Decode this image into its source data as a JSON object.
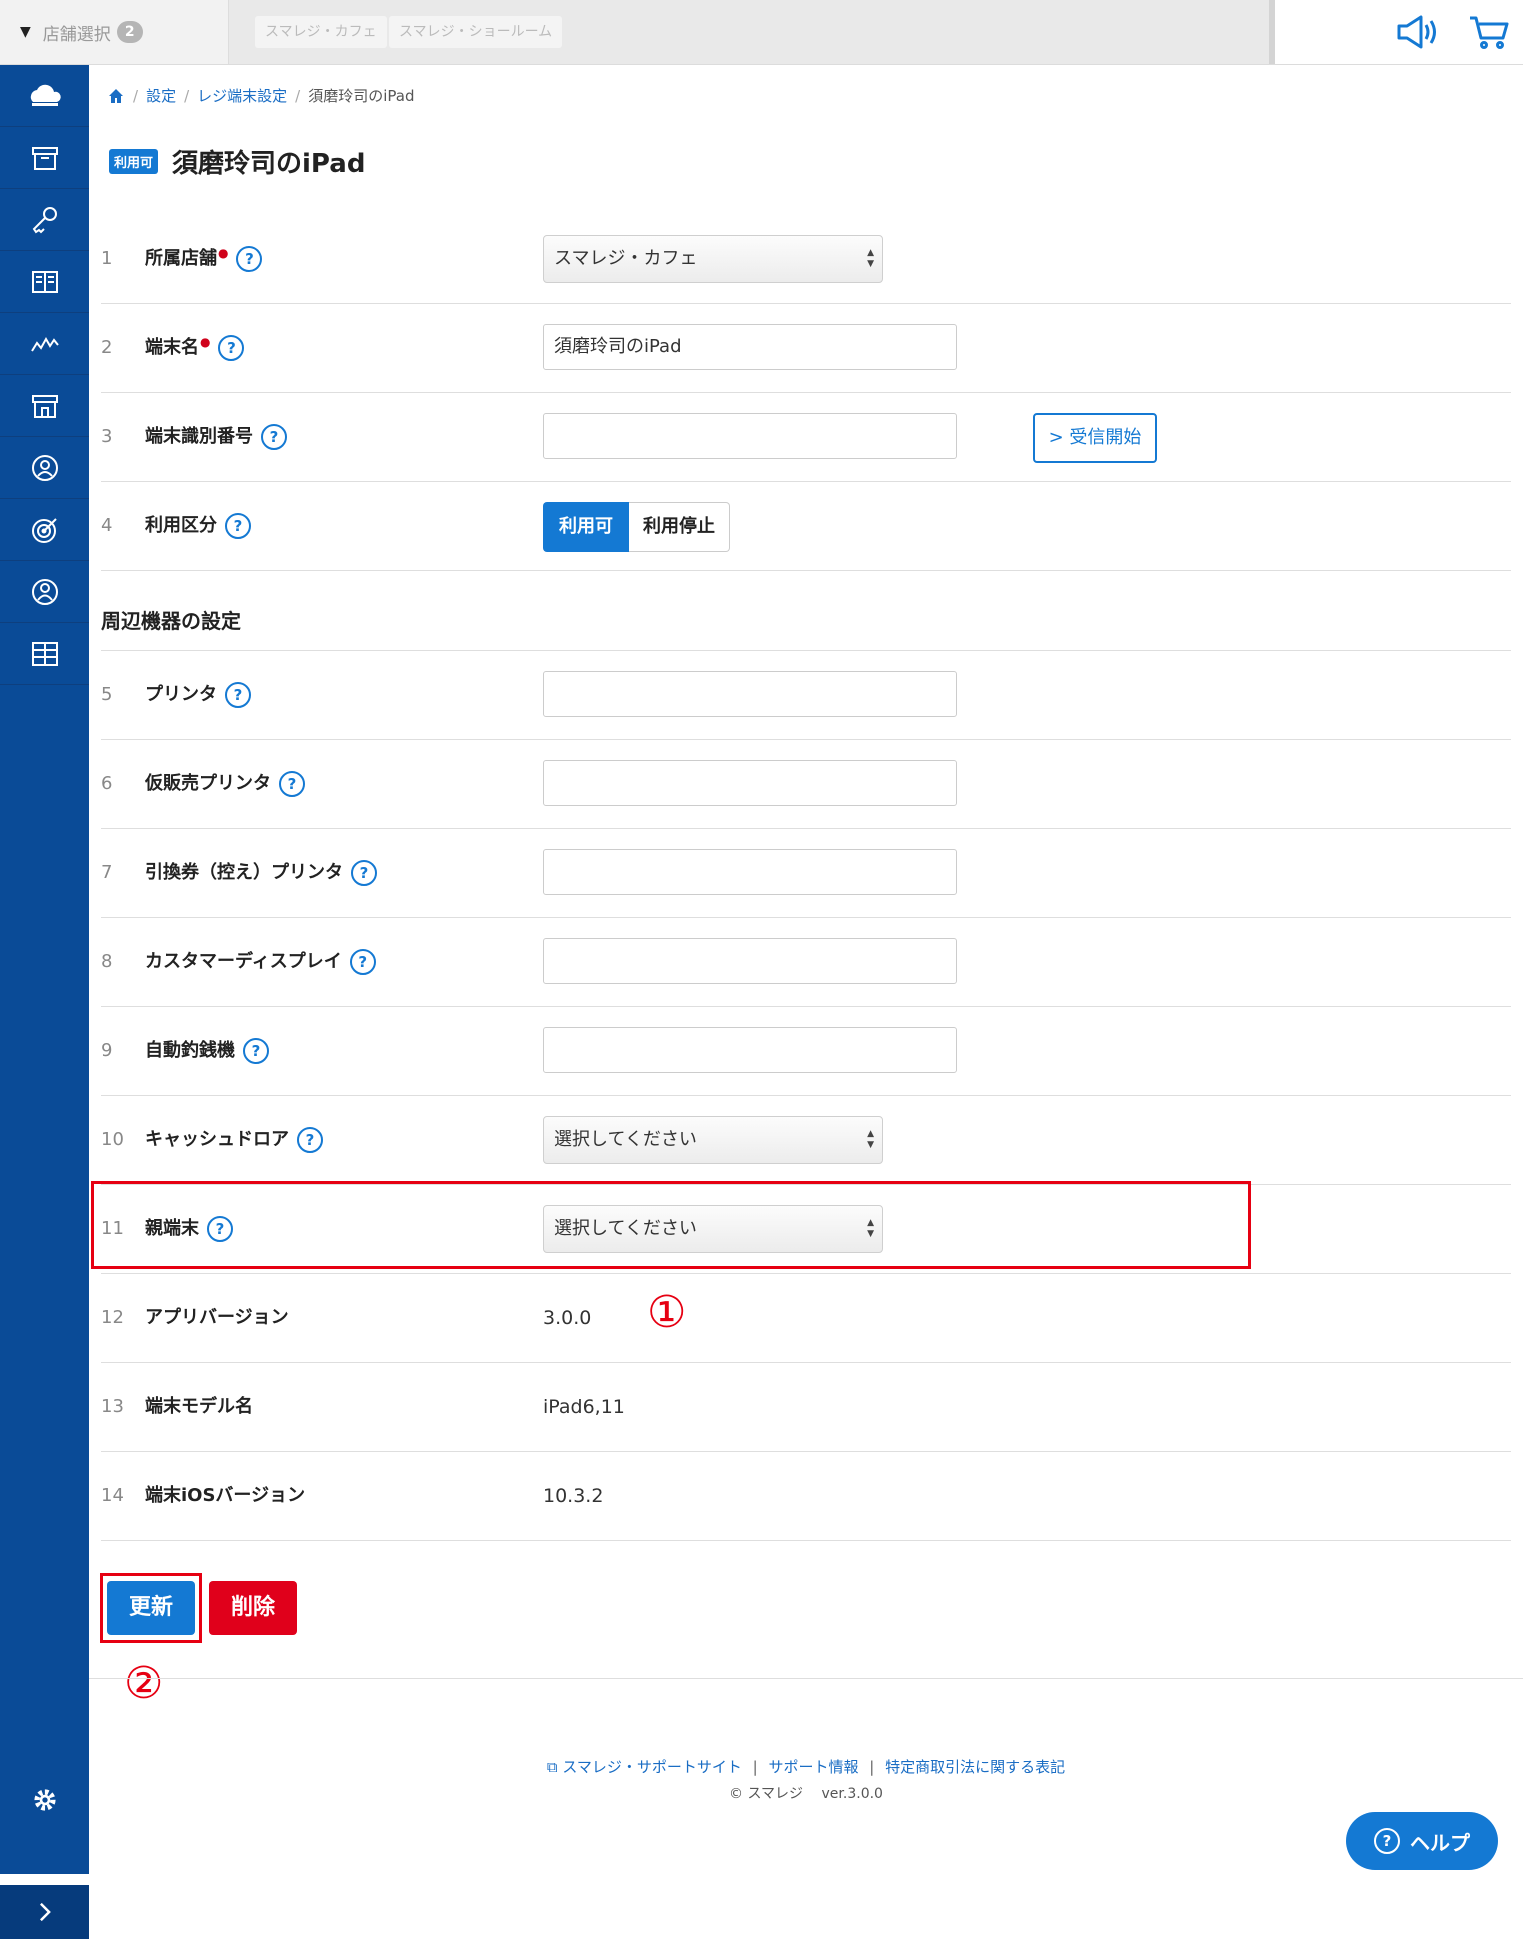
{
  "topbar": {
    "store_select_label": "店舗選択",
    "store_count": "2",
    "store_tabs": [
      "スマレジ・カフェ",
      "スマレジ・ショールーム"
    ]
  },
  "breadcrumb": [
    "設定",
    "レジ端末設定",
    "須磨玲司のiPad"
  ],
  "header": {
    "status_badge": "利用可",
    "title": "須磨玲司のiPad"
  },
  "form": {
    "rows": [
      {
        "num": "1",
        "label": "所属店舗",
        "value": "スマレジ・カフェ"
      },
      {
        "num": "2",
        "label": "端末名",
        "value": "須磨玲司のiPad"
      },
      {
        "num": "3",
        "label": "端末識別番号",
        "value": "",
        "button": "受信開始"
      },
      {
        "num": "4",
        "label": "利用区分",
        "on": "利用可",
        "off": "利用停止"
      }
    ],
    "section_title": "周辺機器の設定",
    "devices": [
      {
        "num": "5",
        "label": "プリンタ",
        "value": ""
      },
      {
        "num": "6",
        "label": "仮販売プリンタ",
        "value": ""
      },
      {
        "num": "7",
        "label": "引換券（控え）プリンタ",
        "value": ""
      },
      {
        "num": "8",
        "label": "カスタマーディスプレイ",
        "value": ""
      },
      {
        "num": "9",
        "label": "自動釣銭機",
        "value": ""
      },
      {
        "num": "10",
        "label": "キャッシュドロア",
        "value": "選択してください"
      },
      {
        "num": "11",
        "label": "親端末",
        "value": "選択してください"
      },
      {
        "num": "12",
        "label": "アプリバージョン",
        "value": "3.0.0"
      },
      {
        "num": "13",
        "label": "端末モデル名",
        "value": "iPad6,11"
      },
      {
        "num": "14",
        "label": "端末iOSバージョン",
        "value": "10.3.2"
      }
    ]
  },
  "annotations": {
    "one": "①",
    "two": "②"
  },
  "actions": {
    "update": "更新",
    "delete": "削除"
  },
  "footer": {
    "links": [
      "スマレジ・サポートサイト",
      "サポート情報",
      "特定商取引法に関する表記"
    ],
    "copyright": "© スマレジ　 ver.3.0.0"
  },
  "help_label": "ヘルプ",
  "colors": {
    "sidebar": "#0a4b97",
    "accent": "#1479d3",
    "danger": "#e0001b",
    "annotation": "#e60012"
  }
}
